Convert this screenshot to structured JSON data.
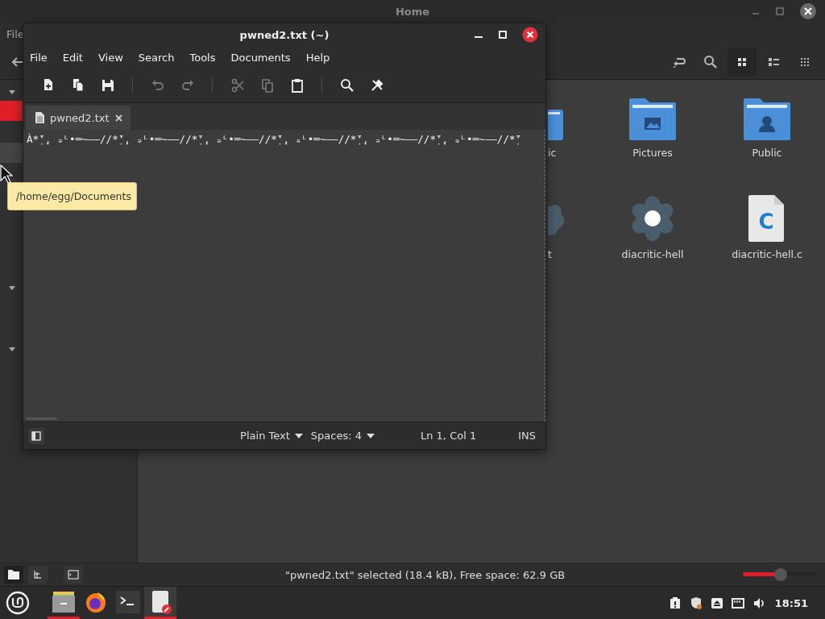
{
  "file_manager": {
    "title": "Home",
    "menu": [
      "File"
    ],
    "sidebar": {
      "sections": [
        {
          "expanded": true,
          "items": [
            {
              "selected": true,
              "hovered": false
            },
            {
              "selected": false,
              "hovered": true
            }
          ]
        },
        {
          "expanded": true
        },
        {
          "expanded": true
        }
      ]
    },
    "view_buttons": [
      {
        "kind": "location",
        "selected": false
      },
      {
        "kind": "search",
        "selected": false
      },
      {
        "kind": "icons",
        "selected": true
      },
      {
        "kind": "list",
        "selected": false
      },
      {
        "kind": "compact",
        "selected": false
      }
    ],
    "items": [
      {
        "name": "ic",
        "kind": "folder-partial"
      },
      {
        "name": "Pictures",
        "kind": "folder-pictures"
      },
      {
        "name": "Public",
        "kind": "folder-public"
      },
      {
        "name": "t",
        "kind": "gear-partial"
      },
      {
        "name": "diacritic-hell",
        "kind": "gear"
      },
      {
        "name": "diacritic-hell.c",
        "kind": "source",
        "icon_letter": "C"
      }
    ],
    "status": "\"pwned2.txt\" selected (18.4 kB), Free space: 62.9 GB",
    "zoom": {
      "level": 0.5
    }
  },
  "tooltip": "/home/egg/Documents",
  "editor": {
    "title": "pwned2.txt (~)",
    "menu": [
      "File",
      "Edit",
      "View",
      "Search",
      "Tools",
      "Documents",
      "Help"
    ],
    "toolbar": [
      {
        "kind": "new",
        "disabled": false
      },
      {
        "kind": "open",
        "disabled": false
      },
      {
        "kind": "save",
        "disabled": false
      },
      {
        "kind": "separator"
      },
      {
        "kind": "undo",
        "disabled": true
      },
      {
        "kind": "redo",
        "disabled": true
      },
      {
        "kind": "separator"
      },
      {
        "kind": "cut",
        "disabled": true
      },
      {
        "kind": "copy",
        "disabled": true
      },
      {
        "kind": "paste",
        "disabled": false
      },
      {
        "kind": "separator"
      },
      {
        "kind": "find",
        "disabled": false
      },
      {
        "kind": "tools",
        "disabled": false
      }
    ],
    "tabs": [
      {
        "label": "pwned2.txt",
        "selected": true
      }
    ],
    "lines": [
      "À*̣̈'̣, ₔᴸ•═~——//*̣̈'̣, ₔᴸ•═~——//*̣̈'̣, ₔᴸ•═~——//*̣̈'̣, ₔᴸ•═~——//*̣̈'̣, ₔᴸ•═~——//*̣̈'̣, ₔᴸ•═~——//*̣̈'"
    ],
    "status": {
      "language": "Plain Text",
      "indent": "Spaces: 4",
      "position": "Ln 1, Col 1",
      "mode": "INS"
    }
  },
  "taskbar": {
    "apps": [
      {
        "kind": "files",
        "running": true
      },
      {
        "kind": "browser",
        "running": false
      },
      {
        "kind": "terminal",
        "running": false
      },
      {
        "kind": "editor",
        "running": true
      }
    ],
    "tray": [
      {
        "kind": "clipboard"
      },
      {
        "kind": "shield"
      },
      {
        "kind": "eject"
      },
      {
        "kind": "network"
      },
      {
        "kind": "volume"
      }
    ],
    "clock": "18:51"
  }
}
